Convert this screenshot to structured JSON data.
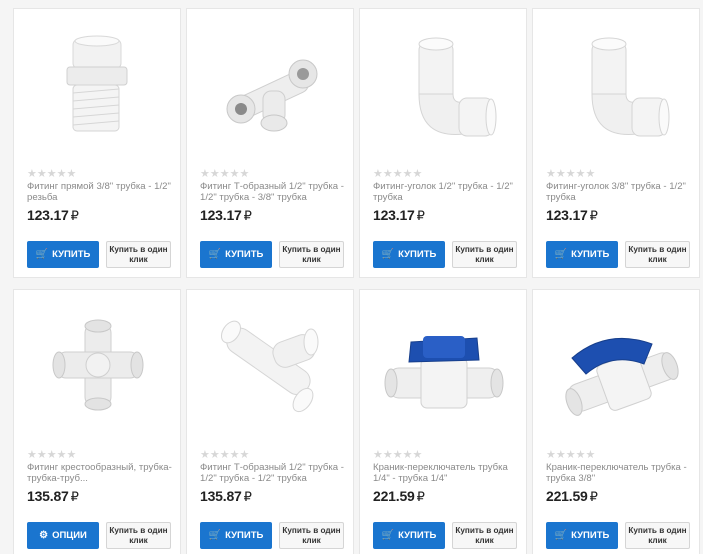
{
  "products": [
    {
      "rating_stars": "★★★★★",
      "title": "Фитинг прямой 3/8\" трубка - 1/2\" резьба",
      "price": "123.17",
      "currency": "₽",
      "buy_label": "КУПИТЬ",
      "buy_icon": "cart-icon",
      "oneclick_label": "Купить в один клик"
    },
    {
      "rating_stars": "★★★★★",
      "title": "Фитинг Т-образный 1/2\" трубка - 1/2\" трубка - 3/8\" трубка",
      "price": "123.17",
      "currency": "₽",
      "buy_label": "КУПИТЬ",
      "buy_icon": "cart-icon",
      "oneclick_label": "Купить в один клик"
    },
    {
      "rating_stars": "★★★★★",
      "title": "Фитинг-уголок 1/2\" трубка - 1/2\" трубка",
      "price": "123.17",
      "currency": "₽",
      "buy_label": "КУПИТЬ",
      "buy_icon": "cart-icon",
      "oneclick_label": "Купить в один клик"
    },
    {
      "rating_stars": "★★★★★",
      "title": "Фитинг-уголок 3/8\" трубка - 1/2\" трубка",
      "price": "123.17",
      "currency": "₽",
      "buy_label": "КУПИТЬ",
      "buy_icon": "cart-icon",
      "oneclick_label": "Купить в один клик"
    },
    {
      "rating_stars": "★★★★★",
      "title": "Фитинг крестообразный, трубка-трубка-труб...",
      "price": "135.87",
      "currency": "₽",
      "buy_label": "ОПЦИИ",
      "buy_icon": "gear-icon",
      "oneclick_label": "Купить в один клик"
    },
    {
      "rating_stars": "★★★★★",
      "title": "Фитинг Т-образный 1/2\" трубка - 1/2\" трубка - 1/2\" трубка",
      "price": "135.87",
      "currency": "₽",
      "buy_label": "КУПИТЬ",
      "buy_icon": "cart-icon",
      "oneclick_label": "Купить в один клик"
    },
    {
      "rating_stars": "★★★★★",
      "title": "Краник-переключатель трубка 1/4\" - трубка 1/4\"",
      "price": "221.59",
      "currency": "₽",
      "buy_label": "КУПИТЬ",
      "buy_icon": "cart-icon",
      "oneclick_label": "Купить в один клик"
    },
    {
      "rating_stars": "★★★★★",
      "title": "Краник-переключатель трубка - трубка 3/8\"",
      "price": "221.59",
      "currency": "₽",
      "buy_label": "КУПИТЬ",
      "buy_icon": "cart-icon",
      "oneclick_label": "Купить в один клик"
    }
  ],
  "colors": {
    "buy_button": "#1a75cf",
    "valve_handle": "#1d4fb0"
  }
}
